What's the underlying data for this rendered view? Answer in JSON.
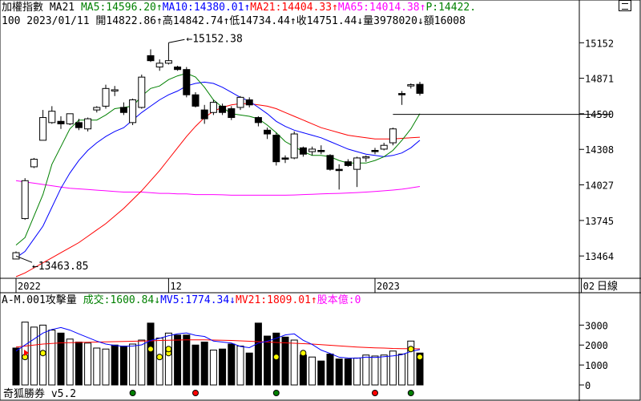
{
  "header": {
    "line1": [
      {
        "text": "加權指數 MA21 ",
        "color": "#000000"
      },
      {
        "text": "MA5:14596.20↑",
        "color": "#008000"
      },
      {
        "text": "MA10:14380.01↑",
        "color": "#0000ff"
      },
      {
        "text": "MA21:14404.33↑",
        "color": "#ff0000"
      },
      {
        "text": "MA65:14014.38↑",
        "color": "#ff00ff"
      },
      {
        "text": "P:14422.",
        "color": "#008000"
      }
    ],
    "line2": [
      {
        "text": "100 2023/01/11 開14822.86↑高14842.74↑低14734.44↑收14751.44↓量3978020↓額16008",
        "color": "#000000"
      }
    ]
  },
  "volume_header": [
    {
      "text": "A-M.001攻擊量 ",
      "color": "#000000"
    },
    {
      "text": "成交:1600.84↓",
      "color": "#008000"
    },
    {
      "text": "MV5:1774.34↓",
      "color": "#0000ff"
    },
    {
      "text": "MV21:1809.01↑",
      "color": "#ff0000"
    },
    {
      "text": "股本億:0",
      "color": "#ff00ff"
    }
  ],
  "footer": {
    "brand": "奇狐勝券 v5.2"
  },
  "period_label": "日線",
  "chart_data": {
    "type": "candlestick",
    "price_axis": {
      "min": 13300,
      "max": 15300,
      "ticks": [
        15152,
        14871,
        14590,
        14308,
        14027,
        13745,
        13464
      ]
    },
    "volume_axis": {
      "min": 0,
      "max": 4100,
      "ticks": [
        3000,
        2000,
        1000,
        0
      ]
    },
    "x_labels": [
      "2022",
      "12",
      "2023",
      "02"
    ],
    "x_label_index": [
      0,
      17,
      40,
      63
    ],
    "annotations": [
      {
        "label": "15152.38",
        "index": 17,
        "value": 15152.38
      },
      {
        "label": "13463.85",
        "index": 0,
        "value": 13463.85
      }
    ],
    "hline": {
      "value": 14585
    },
    "candles": [
      {
        "o": 13440,
        "h": 13500,
        "l": 13440,
        "c": 13490
      },
      {
        "o": 13760,
        "h": 14080,
        "l": 13750,
        "c": 14060
      },
      {
        "o": 14170,
        "h": 14240,
        "l": 14160,
        "c": 14230
      },
      {
        "o": 14380,
        "h": 14620,
        "l": 14380,
        "c": 14560
      },
      {
        "o": 14520,
        "h": 14650,
        "l": 14510,
        "c": 14610
      },
      {
        "o": 14530,
        "h": 14570,
        "l": 14470,
        "c": 14510
      },
      {
        "o": 14510,
        "h": 14590,
        "l": 14500,
        "c": 14590
      },
      {
        "o": 14520,
        "h": 14550,
        "l": 14460,
        "c": 14480
      },
      {
        "o": 14470,
        "h": 14560,
        "l": 14450,
        "c": 14550
      },
      {
        "o": 14620,
        "h": 14650,
        "l": 14600,
        "c": 14640
      },
      {
        "o": 14650,
        "h": 14820,
        "l": 14630,
        "c": 14790
      },
      {
        "o": 14770,
        "h": 14810,
        "l": 14730,
        "c": 14780
      },
      {
        "o": 14640,
        "h": 14680,
        "l": 14580,
        "c": 14600
      },
      {
        "o": 14520,
        "h": 14710,
        "l": 14500,
        "c": 14700
      },
      {
        "o": 14640,
        "h": 14900,
        "l": 14630,
        "c": 14880
      },
      {
        "o": 15050,
        "h": 15100,
        "l": 15000,
        "c": 15010
      },
      {
        "o": 14960,
        "h": 15020,
        "l": 14930,
        "c": 14990
      },
      {
        "o": 14990,
        "h": 15152,
        "l": 14980,
        "c": 15010
      },
      {
        "o": 14960,
        "h": 14970,
        "l": 14930,
        "c": 14940
      },
      {
        "o": 14940,
        "h": 14960,
        "l": 14720,
        "c": 14740
      },
      {
        "o": 14740,
        "h": 14760,
        "l": 14640,
        "c": 14650
      },
      {
        "o": 14620,
        "h": 14660,
        "l": 14510,
        "c": 14550
      },
      {
        "o": 14600,
        "h": 14700,
        "l": 14580,
        "c": 14680
      },
      {
        "o": 14650,
        "h": 14670,
        "l": 14580,
        "c": 14600
      },
      {
        "o": 14630,
        "h": 14650,
        "l": 14540,
        "c": 14560
      },
      {
        "o": 14640,
        "h": 14730,
        "l": 14620,
        "c": 14720
      },
      {
        "o": 14700,
        "h": 14720,
        "l": 14640,
        "c": 14660
      },
      {
        "o": 14560,
        "h": 14570,
        "l": 14490,
        "c": 14520
      },
      {
        "o": 14460,
        "h": 14480,
        "l": 14390,
        "c": 14430
      },
      {
        "o": 14420,
        "h": 14440,
        "l": 14180,
        "c": 14210
      },
      {
        "o": 14240,
        "h": 14260,
        "l": 14200,
        "c": 14230
      },
      {
        "o": 14240,
        "h": 14450,
        "l": 14230,
        "c": 14430
      },
      {
        "o": 14320,
        "h": 14330,
        "l": 14250,
        "c": 14270
      },
      {
        "o": 14290,
        "h": 14330,
        "l": 14260,
        "c": 14310
      },
      {
        "o": 14300,
        "h": 14340,
        "l": 14270,
        "c": 14290
      },
      {
        "o": 14260,
        "h": 14270,
        "l": 14140,
        "c": 14150
      },
      {
        "o": 14150,
        "h": 14190,
        "l": 13990,
        "c": 14140
      },
      {
        "o": 14210,
        "h": 14230,
        "l": 14170,
        "c": 14180
      },
      {
        "o": 14150,
        "h": 14250,
        "l": 14010,
        "c": 14240
      },
      {
        "o": 14240,
        "h": 14260,
        "l": 14210,
        "c": 14250
      },
      {
        "o": 14300,
        "h": 14320,
        "l": 14270,
        "c": 14290
      },
      {
        "o": 14310,
        "h": 14360,
        "l": 14300,
        "c": 14340
      },
      {
        "o": 14360,
        "h": 14480,
        "l": 14340,
        "c": 14470
      },
      {
        "o": 14750,
        "h": 14770,
        "l": 14660,
        "c": 14740
      },
      {
        "o": 14810,
        "h": 14830,
        "l": 14790,
        "c": 14820
      },
      {
        "o": 14822.86,
        "h": 14842.74,
        "l": 14734.44,
        "c": 14751.44
      }
    ],
    "ma5": [
      13550,
      13610,
      13780,
      13950,
      14190,
      14330,
      14470,
      14540,
      14540,
      14540,
      14580,
      14630,
      14640,
      14650,
      14730,
      14790,
      14810,
      14860,
      14890,
      14910,
      14880,
      14800,
      14700,
      14640,
      14590,
      14580,
      14570,
      14550,
      14500,
      14440,
      14370,
      14330,
      14290,
      14260,
      14260,
      14250,
      14220,
      14200,
      14200,
      14200,
      14220,
      14250,
      14300,
      14380,
      14470,
      14590
    ],
    "ma10": [
      13450,
      13500,
      13600,
      13700,
      13850,
      14000,
      14120,
      14220,
      14300,
      14360,
      14410,
      14450,
      14480,
      14540,
      14600,
      14650,
      14700,
      14740,
      14770,
      14810,
      14830,
      14840,
      14830,
      14800,
      14760,
      14720,
      14690,
      14640,
      14590,
      14530,
      14490,
      14460,
      14440,
      14420,
      14400,
      14370,
      14340,
      14310,
      14290,
      14270,
      14260,
      14250,
      14260,
      14280,
      14320,
      14380
    ],
    "ma21": [
      13300,
      13330,
      13370,
      13410,
      13450,
      13490,
      13530,
      13570,
      13620,
      13670,
      13720,
      13780,
      13840,
      13910,
      13980,
      14060,
      14140,
      14230,
      14320,
      14410,
      14490,
      14560,
      14610,
      14640,
      14660,
      14670,
      14670,
      14660,
      14650,
      14630,
      14600,
      14570,
      14540,
      14510,
      14480,
      14460,
      14440,
      14420,
      14410,
      14400,
      14390,
      14390,
      14390,
      14395,
      14400,
      14404
    ],
    "ma65": [
      14060,
      14050,
      14040,
      14030,
      14020,
      14010,
      14000,
      13995,
      13990,
      13985,
      13980,
      13975,
      13970,
      13970,
      13970,
      13965,
      13960,
      13960,
      13955,
      13955,
      13950,
      13950,
      13950,
      13948,
      13945,
      13945,
      13945,
      13945,
      13945,
      13945,
      13945,
      13947,
      13950,
      13952,
      13955,
      13958,
      13960,
      13963,
      13966,
      13970,
      13975,
      13980,
      13986,
      13993,
      14003,
      14014
    ],
    "volume": [
      1850,
      3150,
      2900,
      3000,
      2750,
      2600,
      2300,
      2150,
      2100,
      1850,
      1800,
      2000,
      1950,
      2050,
      2250,
      3100,
      2350,
      2600,
      2500,
      2500,
      2000,
      2150,
      1750,
      1800,
      2050,
      1950,
      1600,
      3100,
      2450,
      2600,
      2400,
      2250,
      1500,
      1400,
      1200,
      1550,
      1300,
      1300,
      1350,
      1500,
      1450,
      1500,
      1700,
      1550,
      2200,
      1600
    ],
    "mv5": [
      1700,
      2000,
      2300,
      2600,
      2780,
      2880,
      2750,
      2560,
      2380,
      2200,
      2050,
      1980,
      1940,
      1950,
      2010,
      2230,
      2340,
      2470,
      2560,
      2610,
      2490,
      2430,
      2200,
      2150,
      2100,
      1930,
      1870,
      2100,
      2190,
      2340,
      2510,
      2560,
      2240,
      2030,
      1750,
      1580,
      1390,
      1350,
      1340,
      1400,
      1380,
      1420,
      1460,
      1520,
      1680,
      1774
    ],
    "mv21": [
      1900,
      1950,
      2000,
      2050,
      2080,
      2110,
      2120,
      2130,
      2140,
      2150,
      2160,
      2170,
      2180,
      2190,
      2200,
      2210,
      2230,
      2240,
      2250,
      2260,
      2260,
      2260,
      2250,
      2240,
      2230,
      2210,
      2190,
      2170,
      2150,
      2130,
      2110,
      2090,
      2070,
      2050,
      2020,
      1990,
      1960,
      1930,
      1900,
      1880,
      1860,
      1850,
      1830,
      1820,
      1815,
      1809
    ],
    "volume_up": [
      0,
      1,
      1,
      1,
      1,
      0,
      1,
      0,
      1,
      1,
      1,
      0,
      0,
      1,
      1,
      0,
      1,
      1,
      0,
      0,
      0,
      0,
      1,
      0,
      0,
      1,
      0,
      0,
      0,
      0,
      0,
      1,
      0,
      1,
      0,
      0,
      0,
      0,
      1,
      1,
      1,
      1,
      1,
      1,
      1,
      0
    ],
    "markers": [
      {
        "index": 1,
        "color": "#ffff00"
      },
      {
        "index": 5,
        "color": "#ffff00"
      },
      {
        "index": 23,
        "color": "#ffff00"
      },
      {
        "index": 24,
        "color": "#ffff00"
      },
      {
        "index": 25,
        "color": "#ffff00"
      },
      {
        "index": 26,
        "color": "#ffff00"
      },
      {
        "index": 43,
        "color": "#ffff00"
      },
      {
        "index": 47,
        "color": "#ffff00"
      },
      {
        "index": 65,
        "color": "#ffff00"
      },
      {
        "index": 67,
        "color": "#ffff00"
      }
    ],
    "bottom_markers": [
      {
        "index": 13,
        "color": "#008000"
      },
      {
        "index": 20,
        "color": "#ff0000"
      },
      {
        "index": 29,
        "color": "#008000"
      },
      {
        "index": 40,
        "color": "#ff0000"
      },
      {
        "index": 44,
        "color": "#008000"
      }
    ],
    "colors": {
      "up": "#ffffff",
      "down": "#000000",
      "ma5": "#008000",
      "ma10": "#0000ff",
      "ma21": "#ff0000",
      "ma65": "#ff00ff",
      "mv5": "#0000ff",
      "mv21": "#ff0000"
    }
  }
}
